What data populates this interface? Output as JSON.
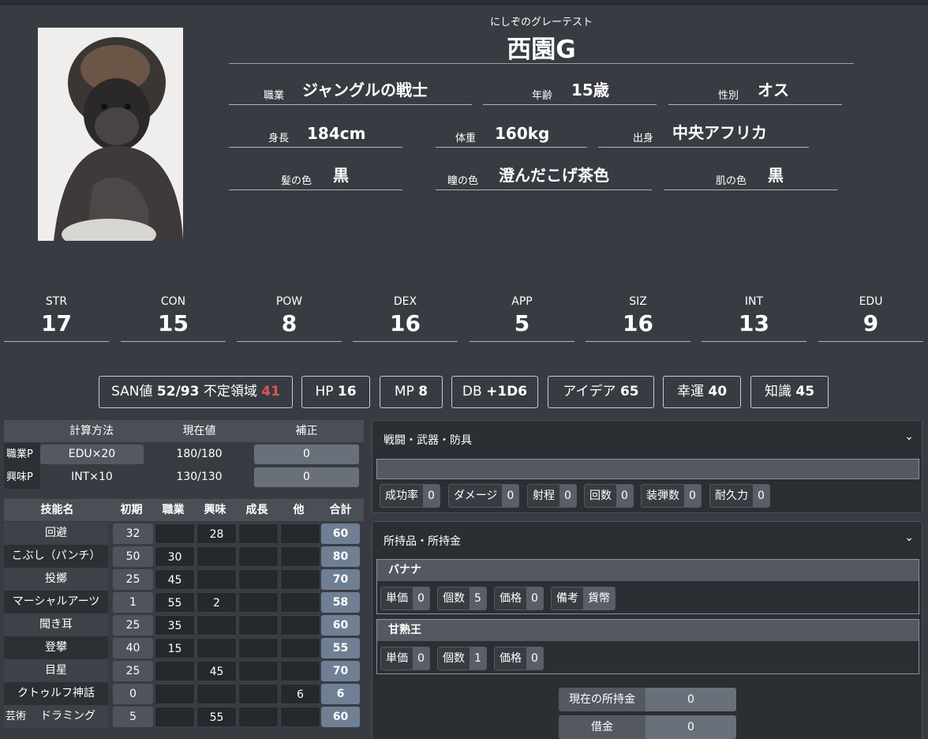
{
  "profile": {
    "ruby": "にしぞのグレーテスト",
    "name": "西園G",
    "fields": [
      {
        "label": "職業",
        "value": "ジャングルの戦士"
      },
      {
        "label": "年齢",
        "value": "15歳"
      },
      {
        "label": "性別",
        "value": "オス"
      },
      {
        "label": "身長",
        "value": "184cm"
      },
      {
        "label": "体重",
        "value": "160kg"
      },
      {
        "label": "出身",
        "value": "中央アフリカ"
      },
      {
        "label": "髪の色",
        "value": "黒"
      },
      {
        "label": "瞳の色",
        "value": "澄んだこげ茶色"
      },
      {
        "label": "肌の色",
        "value": "黒"
      }
    ]
  },
  "stats": [
    {
      "key": "STR",
      "value": "17"
    },
    {
      "key": "CON",
      "value": "15"
    },
    {
      "key": "POW",
      "value": "8"
    },
    {
      "key": "DEX",
      "value": "16"
    },
    {
      "key": "APP",
      "value": "5"
    },
    {
      "key": "SIZ",
      "value": "16"
    },
    {
      "key": "INT",
      "value": "13"
    },
    {
      "key": "EDU",
      "value": "9"
    }
  ],
  "badges": {
    "san_label": "SAN値",
    "san_value": "52/93",
    "unstable_label": "不定領域",
    "unstable_value": "41",
    "hp_label": "HP",
    "hp_value": "16",
    "mp_label": "MP",
    "mp_value": "8",
    "db_label": "DB",
    "db_value": "+1D6",
    "idea_label": "アイデア",
    "idea_value": "65",
    "luck_label": "幸運",
    "luck_value": "40",
    "know_label": "知識",
    "know_value": "45"
  },
  "points": {
    "headers": [
      "計算方法",
      "現在値",
      "補正"
    ],
    "rows": [
      {
        "label": "職業P",
        "method": "EDU×20",
        "current": "180/180",
        "mod": "0"
      },
      {
        "label": "興味P",
        "method": "INT×10",
        "current": "130/130",
        "mod": "0"
      }
    ]
  },
  "skills": {
    "headers": [
      "技能名",
      "初期",
      "職業",
      "興味",
      "成長",
      "他",
      "合計"
    ],
    "rows": [
      {
        "prefix": "",
        "name": "回避",
        "init": "32",
        "job": "",
        "hobby": "28",
        "growth": "",
        "other": "",
        "total": "60"
      },
      {
        "prefix": "",
        "name": "こぶし（パンチ）",
        "init": "50",
        "job": "30",
        "hobby": "",
        "growth": "",
        "other": "",
        "total": "80"
      },
      {
        "prefix": "",
        "name": "投擲",
        "init": "25",
        "job": "45",
        "hobby": "",
        "growth": "",
        "other": "",
        "total": "70"
      },
      {
        "prefix": "",
        "name": "マーシャルアーツ",
        "init": "1",
        "job": "55",
        "hobby": "2",
        "growth": "",
        "other": "",
        "total": "58"
      },
      {
        "prefix": "",
        "name": "聞き耳",
        "init": "25",
        "job": "35",
        "hobby": "",
        "growth": "",
        "other": "",
        "total": "60"
      },
      {
        "prefix": "",
        "name": "登攀",
        "init": "40",
        "job": "15",
        "hobby": "",
        "growth": "",
        "other": "",
        "total": "55"
      },
      {
        "prefix": "",
        "name": "目星",
        "init": "25",
        "job": "",
        "hobby": "45",
        "growth": "",
        "other": "",
        "total": "70"
      },
      {
        "prefix": "",
        "name": "クトゥルフ神話",
        "init": "0",
        "job": "",
        "hobby": "",
        "growth": "",
        "other": "6",
        "total": "6"
      },
      {
        "prefix": "芸術",
        "name": "ドラミング",
        "init": "5",
        "job": "",
        "hobby": "55",
        "growth": "",
        "other": "",
        "total": "60"
      }
    ]
  },
  "combat": {
    "title": "戦闘・武器・防具",
    "chips": [
      {
        "k": "成功率",
        "v": "0"
      },
      {
        "k": "ダメージ",
        "v": "0"
      },
      {
        "k": "射程",
        "v": "0"
      },
      {
        "k": "回数",
        "v": "0"
      },
      {
        "k": "装弾数",
        "v": "0"
      },
      {
        "k": "耐久力",
        "v": "0"
      }
    ]
  },
  "items": {
    "title": "所持品・所持金",
    "list": [
      {
        "name": "バナナ",
        "chips": [
          {
            "k": "単価",
            "v": "0"
          },
          {
            "k": "個数",
            "v": "5"
          },
          {
            "k": "価格",
            "v": "0"
          },
          {
            "k": "備考",
            "v": "貨幣"
          }
        ]
      },
      {
        "name": "甘熟王",
        "chips": [
          {
            "k": "単価",
            "v": "0"
          },
          {
            "k": "個数",
            "v": "1"
          },
          {
            "k": "価格",
            "v": "0"
          }
        ]
      }
    ],
    "money_label": "現在の所持金",
    "money_value": "0",
    "debt_label": "借金",
    "debt_value": "0"
  },
  "colors": {
    "background": "#383c42",
    "accent_total": "#6f7f94",
    "warning": "#e05252"
  }
}
